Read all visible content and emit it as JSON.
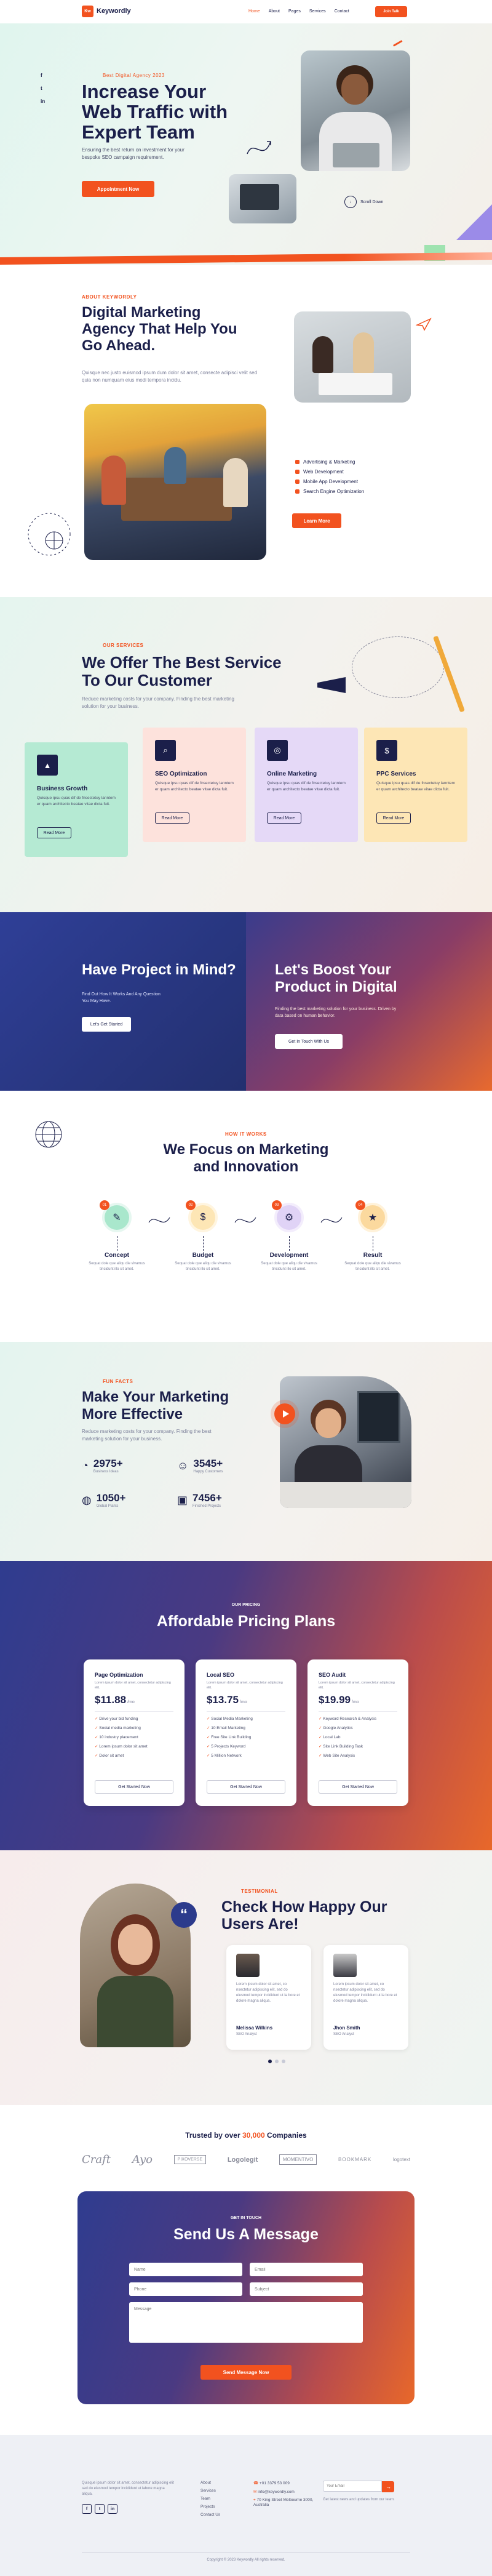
{
  "colors": {
    "accent": "#f2521f",
    "navy": "#1b1f4a",
    "blue": "#2c3b8c"
  },
  "nav": {
    "logo_mark": "Kw",
    "brand": "Keywordly",
    "links": [
      "Home",
      "About",
      "Pages",
      "Services",
      "Contact"
    ],
    "cta": "Join Talk"
  },
  "hero": {
    "eyebrow": "Best Digital Agency 2023",
    "title_lines": [
      "Increase Your",
      "Web Traffic with",
      "Expert Team"
    ],
    "body": "Ensuring the best return on investment for your bespoke SEO campaign requirement.",
    "cta": "Appointment Now",
    "badge": "Scroll Down",
    "social": [
      "f",
      "t",
      "in"
    ]
  },
  "about": {
    "eyebrow": "ABOUT KEYWORDLY",
    "title_lines": [
      "Digital Marketing",
      "Agency That Help You",
      "Go Ahead."
    ],
    "body": "Quisque nec justo euismod ipsum dum dolor sit amet, consecte adipisci velit sed quia non numquam eius modi tempora incidu.",
    "list": [
      "Advertising & Marketing",
      "Web Development",
      "Mobile App Development",
      "Search Engine Optimization"
    ],
    "cta": "Learn More"
  },
  "services": {
    "eyebrow": "OUR SERVICES",
    "title_lines": [
      "We Offer The Best Service",
      "To Our Customer"
    ],
    "body": "Reduce marketing costs for your company. Finding the best marketing solution for your business.",
    "cards": [
      {
        "title": "Business Growth",
        "desc": "Quisque ipsu quas dif de fnsectetuy lanntem er quam architecto beatae vitae dicta fuit.",
        "btn": "Read More"
      },
      {
        "title": "SEO Optimization",
        "desc": "Quisque ipsu quas dif de fnsectetuy lanntem er quam architecto beatae vitae dicta fuit.",
        "btn": "Read More"
      },
      {
        "title": "Online Marketing",
        "desc": "Quisque ipsu quas dif de fnsectetuy lanntem er quam architecto beatae vitae dicta fuit.",
        "btn": "Read More"
      },
      {
        "title": "PPC Services",
        "desc": "Quisque ipsu quas dif de fnsectetuy lanntem er quam architecto beatae vitae dicta fuit.",
        "btn": "Read More"
      }
    ]
  },
  "cta_band": {
    "left_title": "Have Project in Mind?",
    "left_body": "Find Out How It Works And Any Question You May Have.",
    "left_btn": "Let's Get Started",
    "right_title_lines": [
      "Let's Boost Your",
      "Product in Digital"
    ],
    "right_body": "Finding the best marketing solution for your business. Driven by data based on human behavior.",
    "right_btn": "Get In Touch With Us"
  },
  "process": {
    "eyebrow": "HOW IT WORKS",
    "title_lines": [
      "We Focus on Marketing",
      "and Innovation"
    ],
    "steps": [
      {
        "n": "01",
        "title": "Concept",
        "desc": "Sequat dole que aliqu die vivamus tincidunt illo sit amet."
      },
      {
        "n": "02",
        "title": "Budget",
        "desc": "Sequat dole que aliqu die vivamus tincidunt illo sit amet."
      },
      {
        "n": "03",
        "title": "Development",
        "desc": "Sequat dole que aliqu die vivamus tincidunt illo sit amet."
      },
      {
        "n": "04",
        "title": "Result",
        "desc": "Sequat dole que aliqu die vivamus tincidunt illo sit amet."
      }
    ]
  },
  "stats": {
    "eyebrow": "FUN FACTS",
    "title_lines": [
      "Make Your Marketing",
      "More Effective"
    ],
    "body": "Reduce marketing costs for your company. Finding the best marketing solution for your business.",
    "items": [
      {
        "value": "2975+",
        "label": "Business Ideas"
      },
      {
        "value": "3545+",
        "label": "Happy Customers"
      },
      {
        "value": "1050+",
        "label": "Global Plants"
      },
      {
        "value": "7456+",
        "label": "Finished Projects"
      }
    ]
  },
  "pricing": {
    "eyebrow": "OUR PRICING",
    "title": "Affordable Pricing Plans",
    "plans": [
      {
        "name": "Page Optimization",
        "desc": "Lorem ipsum dolor sit amet, consectetur adipiscing elit.",
        "price": "$11.88",
        "period": "/mo",
        "features": [
          "Drive your bid funding",
          "Social media marketing",
          "10 industry placement",
          "Lorem ipsum dolor sit amet",
          "Dolor sit amet"
        ],
        "btn": "Get Started Now"
      },
      {
        "name": "Local SEO",
        "desc": "Lorem ipsum dolor sit amet, consectetur adipiscing elit.",
        "price": "$13.75",
        "period": "/mo",
        "features": [
          "Social Media Marketing",
          "10 Email Marketing",
          "Free Site Link Building",
          "5 Projects Keyword",
          "5 Million Network"
        ],
        "btn": "Get Started Now"
      },
      {
        "name": "SEO Audit",
        "desc": "Lorem ipsum dolor sit amet, consectetur adipiscing elit.",
        "price": "$19.99",
        "period": "/mo",
        "features": [
          "Keyword Research & Analysis",
          "Google Analytics",
          "Local Lab",
          "Site Link Building Task",
          "Web Site Analysis"
        ],
        "btn": "Get Started Now"
      }
    ]
  },
  "testimonials": {
    "eyebrow": "TESTIMONIAL",
    "title_lines": [
      "Check How Happy Our",
      "Users Are!"
    ],
    "items": [
      {
        "quote": "Lorem ipsum dolor sit amet, co nsectetur adipiscing elit, sed do eiusmod tempor incididunt ut la bore et dolore magna aliqua.",
        "name": "Melissa Wilkins",
        "role": "SEO Analyst"
      },
      {
        "quote": "Lorem ipsum dolor sit amet, co nsectetur adipiscing elit, sed do eiusmod tempor incididunt ut la bore et dolore magna aliqua.",
        "name": "Jhon Smith",
        "role": "SEO Analyst"
      }
    ]
  },
  "clients": {
    "title_pre": "Trusted by over",
    "highlight": "30,000",
    "title_post": "Companies",
    "logos": [
      "Craft",
      "Ayo",
      "PIXOVERSE",
      "Logolegit",
      "MOMENTIVO",
      "BOOKMARK",
      "logotext"
    ]
  },
  "contact": {
    "eyebrow": "GET IN TOUCH",
    "title": "Send Us A Message",
    "fields": [
      "Name",
      "Email",
      "Phone",
      "Subject"
    ],
    "message": "Message",
    "btn": "Send Message Now"
  },
  "footer": {
    "about": "Quisque ipsum dolor sit amet, consectetur adipiscing elit sed do eiusmod tempor incididunt ut labore magna aliqua.",
    "social": [
      "f",
      "t",
      "in"
    ],
    "links": [
      "About",
      "Services",
      "Team",
      "Projects",
      "Contact Us"
    ],
    "contact": [
      "+01 3379 53 009",
      "info@keywordly.com",
      "70 King Street Melbourne 3000, Australia"
    ],
    "newsletter_placeholder": "Your Email",
    "newsletter_note": "Get latest news and updates from our team.",
    "copyright": "Copyright © 2023 Keywordly All rights reserved."
  }
}
